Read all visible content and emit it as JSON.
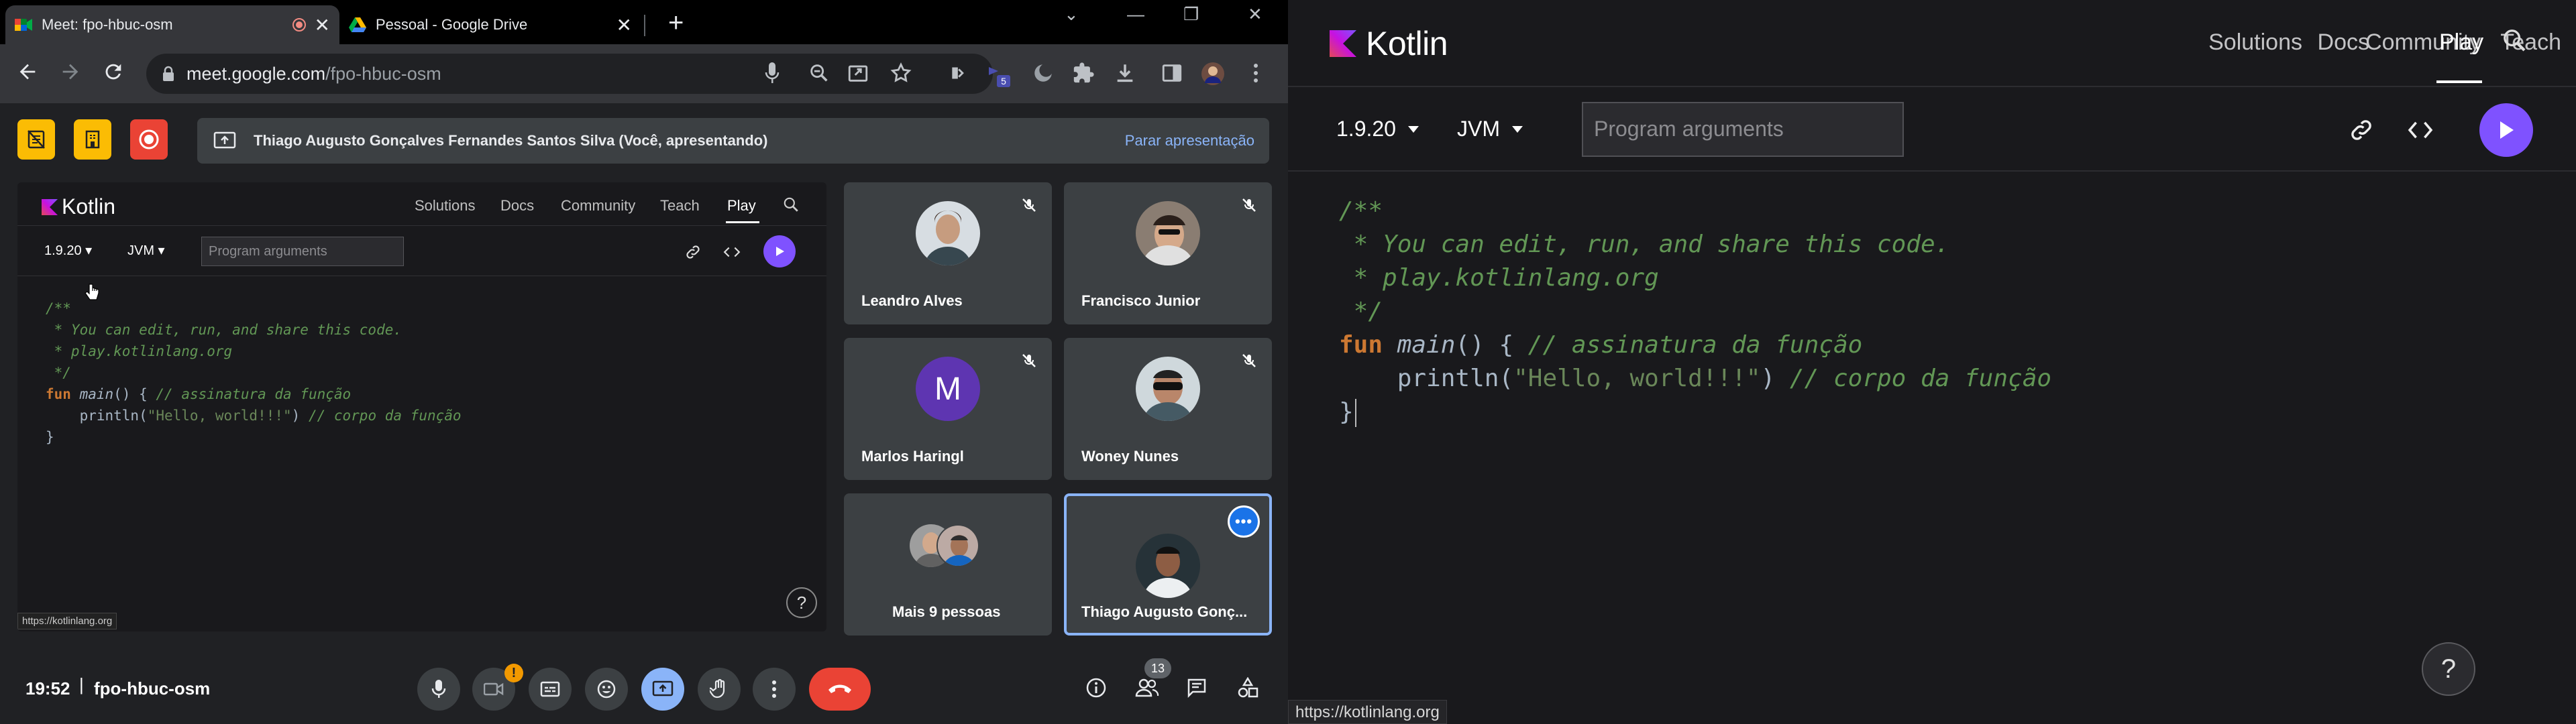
{
  "browser": {
    "tabs": [
      {
        "title": "Meet: fpo-hbuc-osm",
        "active": true
      },
      {
        "title": "Pessoal - Google Drive",
        "active": false
      }
    ],
    "url_host": "meet.google.com",
    "url_path": "/fpo-hbuc-osm",
    "extension_badge": "5"
  },
  "meet": {
    "presenter_banner": "Thiago Augusto Gonçalves Fernandes Santos Silva (Você, apresentando)",
    "stop_presenting": "Parar apresentação",
    "clock": "19:52",
    "separator": "|",
    "meeting_code": "fpo-hbuc-osm",
    "camera_alert": "!",
    "participants_count": "13",
    "participants": [
      {
        "name": "Leandro Alves",
        "muted": true
      },
      {
        "name": "Francisco Junior",
        "muted": true
      },
      {
        "name": "Marlos Haringl",
        "muted": true,
        "initial": "M"
      },
      {
        "name": "Woney Nunes",
        "muted": true
      },
      {
        "name": "Mais 9 pessoas",
        "muted": false
      },
      {
        "name": "Thiago Augusto Gonç...",
        "muted": false,
        "focused": true
      }
    ],
    "shared_status_url": "https://kotlinlang.org"
  },
  "kotlin": {
    "logo_text": "Kotlin",
    "nav": [
      "Solutions",
      "Docs",
      "Community",
      "Teach",
      "Play"
    ],
    "selected_nav": "Play",
    "version": "1.9.20",
    "platform": "JVM",
    "args_placeholder": "Program arguments",
    "help": "?",
    "status_url": "https://kotlinlang.org",
    "code": {
      "line1": "/**",
      "line2": " * You can edit, run, and share this code.",
      "line3": " * play.kotlinlang.org",
      "line4": " */",
      "kw_fun": "fun",
      "fn_name": "main",
      "fn_sig": "() { ",
      "fn_comment": "// assinatura da função",
      "print_indent": "    println(",
      "print_str": "\"Hello, world!!!\"",
      "print_close": ") ",
      "print_comment": "// corpo da função",
      "closing": "}"
    }
  },
  "colors": {
    "kotlin_purple": "#7f52ff",
    "end_call_red": "#ea4335",
    "meet_blue": "#8ab4f8",
    "record_red": "#ea4335",
    "sidebar_yellow": "#fbbc04"
  }
}
